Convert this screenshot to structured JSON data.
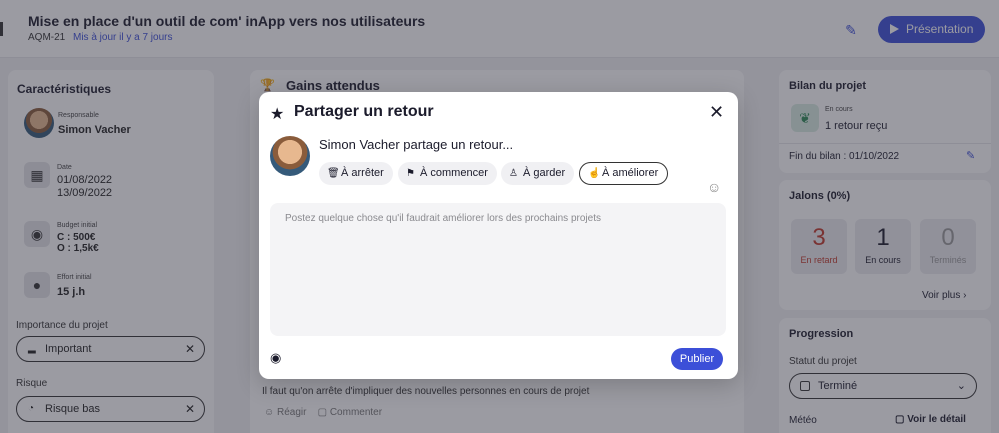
{
  "header": {
    "title": "Mise en place d'un outil de com' inApp vers nos utilisateurs",
    "code": "AQM-21",
    "updated": "Mis à jour il y a 7 jours",
    "present_label": "Présentation"
  },
  "left": {
    "title": "Caractéristiques",
    "responsable_label": "Responsable",
    "responsable": "Simon Vacher",
    "date_label": "Date",
    "date_start": "01/08/2022",
    "date_end": "13/09/2022",
    "budget_label": "Budget initial",
    "budget_c": "C : 500€",
    "budget_o": "O : 1,5k€",
    "effort_label": "Effort initial",
    "effort": "15 j.h",
    "importance_label": "Importance du projet",
    "importance": "Important",
    "risk_label": "Risque",
    "risk": "Risque bas"
  },
  "middle": {
    "title": "Gains attendus",
    "post_text": "Il faut qu'on arrête d'impliquer des nouvelles personnes en cours de projet",
    "react": "Réagir",
    "comment": "Commenter"
  },
  "bilan": {
    "title": "Bilan du projet",
    "status": "En cours",
    "received": "1 retour reçu",
    "end": "Fin du bilan : 01/10/2022"
  },
  "jalons": {
    "title": "Jalons (0%)",
    "late_count": "3",
    "late_label": "En retard",
    "ongoing_count": "1",
    "ongoing_label": "En cours",
    "done_count": "0",
    "done_label": "Terminés",
    "more": "Voir plus"
  },
  "progression": {
    "title": "Progression",
    "status_label": "Statut du projet",
    "status": "Terminé",
    "meteo": "Météo",
    "detail": "Voir le détail"
  },
  "modal": {
    "title": "Partager un retour",
    "who": "Simon Vacher partage un retour...",
    "chips": [
      "À arrêter",
      "À commencer",
      "À garder",
      "À améliorer"
    ],
    "placeholder": "Postez quelque chose qu'il faudrait améliorer lors des prochains projets",
    "publish": "Publier"
  },
  "colors": {
    "accent": "#3c4fd8",
    "late": "#c0392b"
  }
}
